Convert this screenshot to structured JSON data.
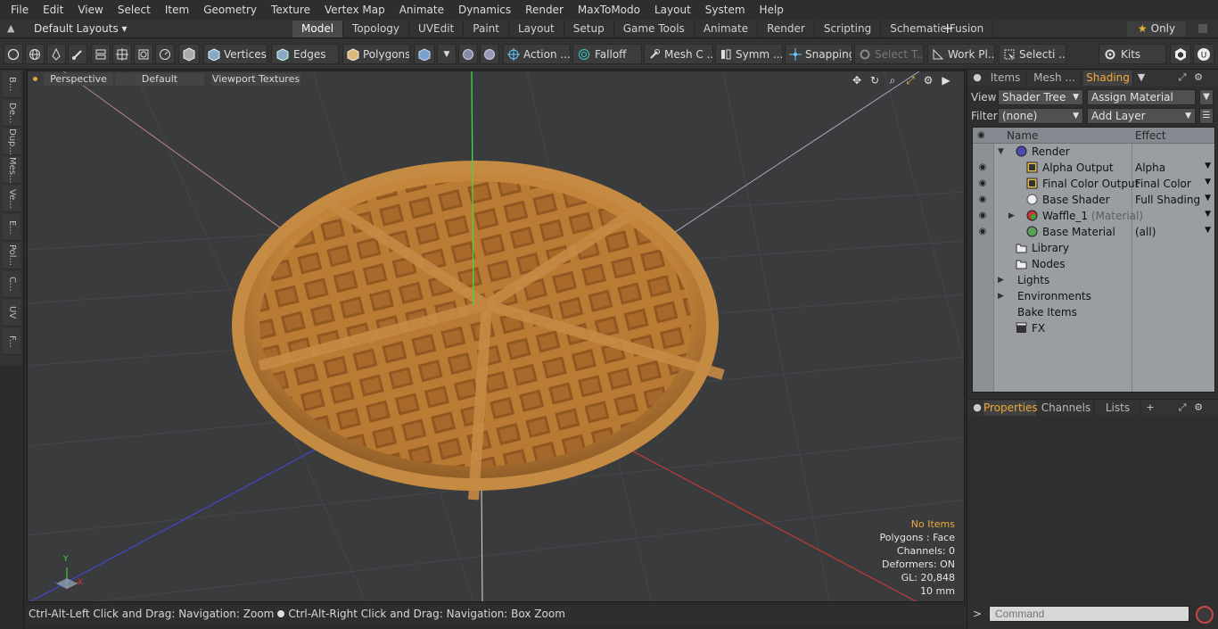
{
  "menubar": [
    "File",
    "Edit",
    "View",
    "Select",
    "Item",
    "Geometry",
    "Texture",
    "Vertex Map",
    "Animate",
    "Dynamics",
    "Render",
    "MaxToModo",
    "Layout",
    "System",
    "Help"
  ],
  "layouts": {
    "label": "Default Layouts ▾"
  },
  "tabs": [
    {
      "label": "Model",
      "active": true
    },
    {
      "label": "Topology"
    },
    {
      "label": "UVEdit"
    },
    {
      "label": "Paint"
    },
    {
      "label": "Layout"
    },
    {
      "label": "Setup"
    },
    {
      "label": "Game Tools"
    },
    {
      "label": "Animate"
    },
    {
      "label": "Render"
    },
    {
      "label": "Scripting"
    },
    {
      "label": "Schematic Fusion"
    }
  ],
  "tab_add": "+",
  "only": {
    "star": "★",
    "label": "Only"
  },
  "toolbar": {
    "vertices": "Vertices",
    "edges": "Edges",
    "polygons": "Polygons",
    "action": "Action ...",
    "falloff": "Falloff",
    "mesh": "Mesh C ...",
    "symm": "Symm ...",
    "snapping": "Snapping",
    "select_t": "Select T...",
    "work_pl": "Work Pl...",
    "selecti": "Selecti ...",
    "kits": "Kits"
  },
  "left_dock": [
    "B...",
    "De...",
    "Dup...",
    "Mes...",
    "Ve...",
    "E...",
    "Pol...",
    "C...",
    "UV",
    "F..."
  ],
  "viewport": {
    "perspective": "Perspective",
    "default": "Default",
    "textures": "Viewport Textures",
    "stats": {
      "items": "No Items",
      "polygons": "Polygons : Face",
      "channels": "Channels: 0",
      "deformers": "Deformers: ON",
      "gl": "GL: 20,848",
      "unit": "10 mm"
    },
    "axis": {
      "y": "Y",
      "x": "X"
    }
  },
  "status": {
    "left": "Ctrl-Alt-Left Click and Drag: Navigation: Zoom",
    "right": "Ctrl-Alt-Right Click and Drag: Navigation: Box Zoom"
  },
  "right_panel": {
    "tabs": [
      {
        "label": "Items"
      },
      {
        "label": "Mesh ..."
      },
      {
        "label": "Shading",
        "active": true
      }
    ],
    "view_label": "View",
    "view_value": "Shader Tree",
    "assign_material": "Assign Material",
    "filter_label": "Filter",
    "filter_value": "(none)",
    "add_layer": "Add Layer",
    "tree_header": {
      "name": "Name",
      "effect": "Effect"
    },
    "tree": [
      {
        "name": "Render",
        "effect": ""
      },
      {
        "name": "Alpha Output",
        "effect": "Alpha"
      },
      {
        "name": "Final Color Output",
        "effect": "Final Color"
      },
      {
        "name": "Base Shader",
        "effect": "Full Shading"
      },
      {
        "name": "Waffle_1",
        "suffix": "(Material)",
        "effect": ""
      },
      {
        "name": "Base Material",
        "effect": "(all)"
      },
      {
        "name": "Library",
        "effect": ""
      },
      {
        "name": "Nodes",
        "effect": ""
      },
      {
        "name": "Lights",
        "effect": ""
      },
      {
        "name": "Environments",
        "effect": ""
      },
      {
        "name": "Bake Items",
        "effect": ""
      },
      {
        "name": "FX",
        "effect": ""
      }
    ],
    "lower_tabs": [
      {
        "label": "Properties",
        "active": true
      },
      {
        "label": "Channels"
      },
      {
        "label": "Lists"
      }
    ],
    "lower_add": "+",
    "command_prompt": ">",
    "command_placeholder": "Command"
  },
  "colors": {
    "accent": "#f0a93a",
    "viewport_bg": "#3a3b3d",
    "waffle": "#c98a3d"
  }
}
